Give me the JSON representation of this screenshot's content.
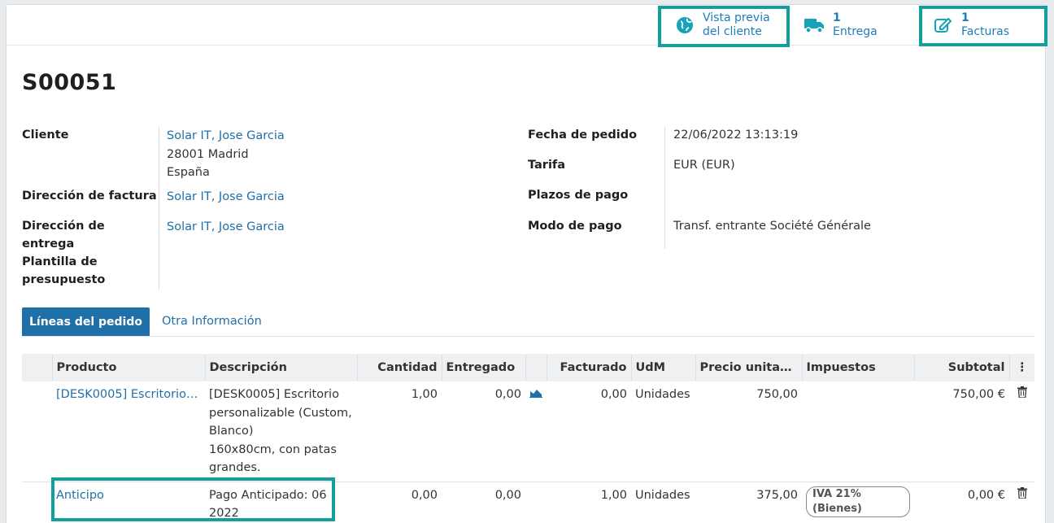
{
  "smart_buttons": {
    "preview": {
      "line1": "Vista previa",
      "line2": "del cliente",
      "icon": "globe-icon"
    },
    "delivery": {
      "count": "1",
      "label": "Entrega",
      "icon": "truck-icon"
    },
    "invoices": {
      "count": "1",
      "label": "Facturas",
      "icon": "edit-icon"
    }
  },
  "order": {
    "name": "S00051"
  },
  "fields_left": {
    "customer_label": "Cliente",
    "customer_name": "Solar IT, Jose Garcia",
    "customer_addr1": "28001 Madrid",
    "customer_addr2": "España",
    "invoice_addr_label": "Dirección de factura",
    "invoice_addr_value": "Solar IT, Jose Garcia",
    "delivery_addr_label_1": "Dirección de",
    "delivery_addr_label_2": "entrega",
    "delivery_addr_value": "Solar IT, Jose Garcia",
    "template_label_1": "Plantilla de",
    "template_label_2": "presupuesto"
  },
  "fields_right": {
    "date_label": "Fecha de pedido",
    "date_value": "22/06/2022 13:13:19",
    "pricelist_label": "Tarifa",
    "pricelist_value": "EUR (EUR)",
    "terms_label": "Plazos de pago",
    "payment_mode_label": "Modo de pago",
    "payment_mode_value": "Transf. entrante Société Générale"
  },
  "tabs": {
    "order_lines": "Líneas del pedido",
    "other_info": "Otra Información"
  },
  "table": {
    "headers": {
      "product": "Producto",
      "description": "Descripción",
      "quantity": "Cantidad",
      "delivered": "Entregado",
      "invoiced": "Facturado",
      "uom": "UdM",
      "unit_price": "Precio unitario...",
      "taxes": "Impuestos",
      "subtotal": "Subtotal"
    },
    "rows": [
      {
        "product": "[DESK0005] Escritorio p...",
        "description": [
          "[DESK0005] Escritorio",
          "personalizable (Custom,",
          "Blanco)",
          "160x80cm, con patas",
          "grandes."
        ],
        "quantity": "1,00",
        "delivered": "0,00",
        "invoiced": "0,00",
        "uom": "Unidades",
        "unit_price": "750,00",
        "tax": "",
        "subtotal": "750,00 €"
      },
      {
        "product": "Anticipo",
        "description": [
          "Pago Anticipado: 06",
          "2022"
        ],
        "quantity": "0,00",
        "delivered": "0,00",
        "invoiced": "1,00",
        "uom": "Unidades",
        "unit_price": "375,00",
        "tax": "IVA 21% (Bienes)",
        "subtotal": "0,00 €"
      }
    ]
  },
  "colors": {
    "primary": "#1f6fa8",
    "highlight": "#12a19a",
    "smart_icon": "#17a2b8"
  }
}
